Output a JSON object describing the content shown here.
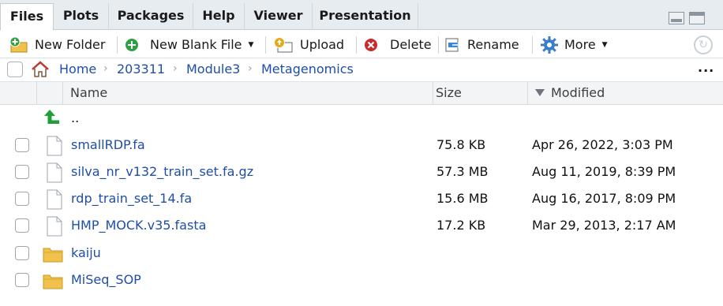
{
  "tabs": [
    {
      "label": "Files",
      "active": true
    },
    {
      "label": "Plots",
      "active": false
    },
    {
      "label": "Packages",
      "active": false
    },
    {
      "label": "Help",
      "active": false
    },
    {
      "label": "Viewer",
      "active": false
    },
    {
      "label": "Presentation",
      "active": false
    }
  ],
  "toolbar": {
    "new_folder": "New Folder",
    "new_blank_file": "New Blank File",
    "upload": "Upload",
    "delete": "Delete",
    "rename": "Rename",
    "more": "More"
  },
  "breadcrumb": {
    "items": [
      "Home",
      "203311",
      "Module3",
      "Metagenomics"
    ],
    "overflow": "..."
  },
  "columns": {
    "name": "Name",
    "size": "Size",
    "modified": "Modified"
  },
  "parent_dir": "..",
  "files": [
    {
      "name": "smallRDP.fa",
      "size": "75.8 KB",
      "modified": "Apr 26, 2022, 3:03 PM",
      "type": "file"
    },
    {
      "name": "silva_nr_v132_train_set.fa.gz",
      "size": "57.3 MB",
      "modified": "Aug 11, 2019, 8:39 PM",
      "type": "file"
    },
    {
      "name": "rdp_train_set_14.fa",
      "size": "15.6 MB",
      "modified": "Aug 16, 2017, 8:09 PM",
      "type": "file"
    },
    {
      "name": "HMP_MOCK.v35.fasta",
      "size": "17.2 KB",
      "modified": "Mar 29, 2013, 2:17 AM",
      "type": "file"
    },
    {
      "name": "kaiju",
      "size": "",
      "modified": "",
      "type": "folder"
    },
    {
      "name": "MiSeq_SOP",
      "size": "",
      "modified": "",
      "type": "folder"
    }
  ],
  "colors": {
    "link": "#1f4da8",
    "tabbar_bg": "#e7ecf1",
    "folder": "#f0c14b",
    "up_arrow": "#1f9e3a"
  }
}
